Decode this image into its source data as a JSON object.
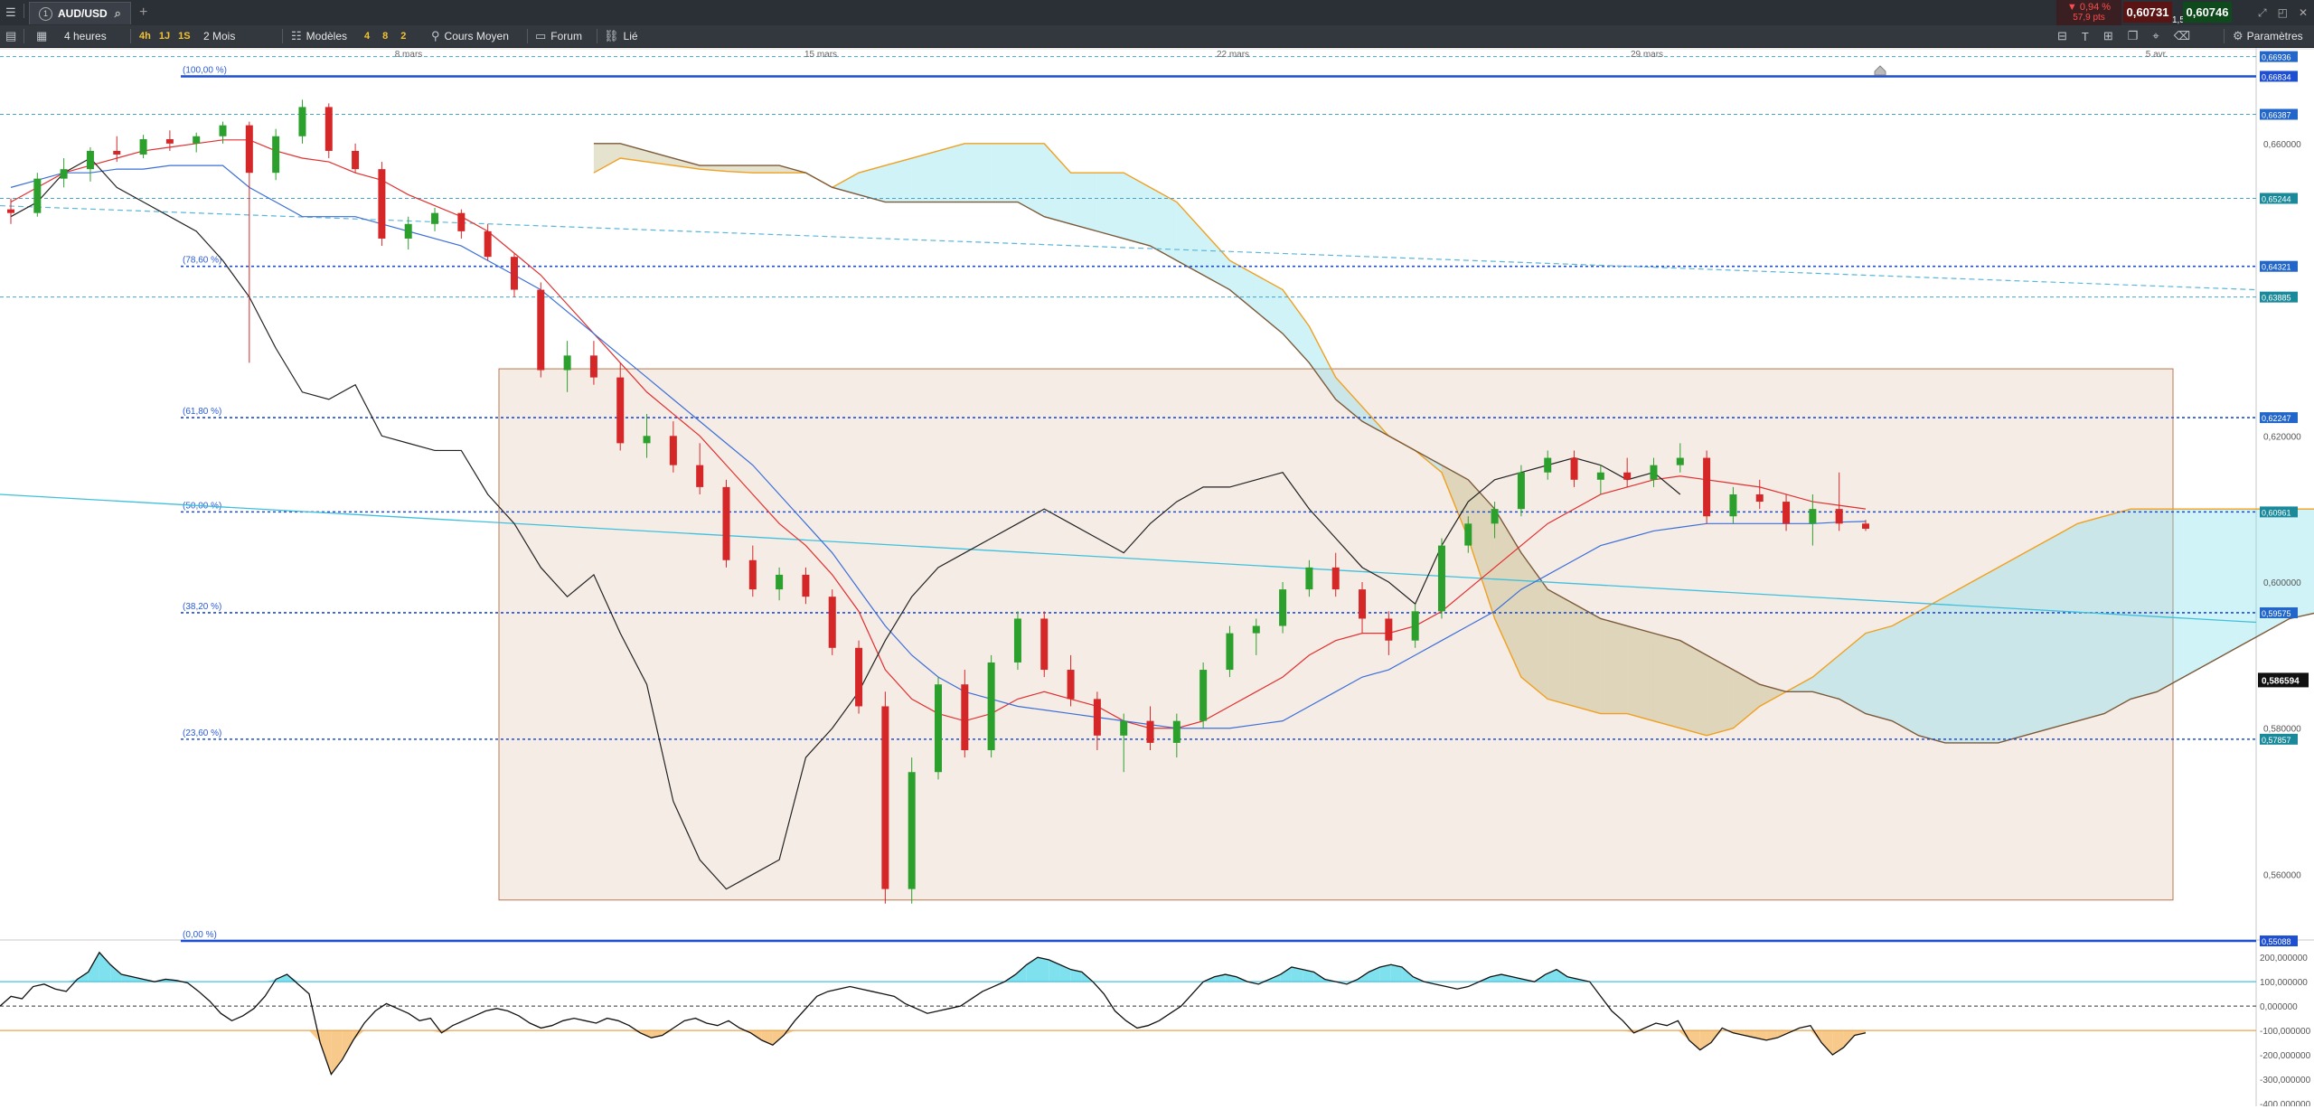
{
  "topbar": {
    "menu_icon": "hamburger-icon",
    "instrument": "AUD/USD",
    "instrument_badge": "1",
    "add_tab": "+",
    "change_pct": "▼ 0,94 %",
    "change_pts": "57,9 pts",
    "bid": "0,60731",
    "spread": "1,5",
    "ask": "0,60746",
    "window_icons": [
      "minimize-icon",
      "restore-icon",
      "close-icon"
    ]
  },
  "toolbar": {
    "timeframe": "4 heures",
    "tf_buttons": [
      "4h",
      "1J",
      "1S"
    ],
    "range": "2 Mois",
    "templates": "Modèles",
    "template_counts": [
      "4",
      "8",
      "2"
    ],
    "average_price": "Cours Moyen",
    "forum": "Forum",
    "linked": "Lié",
    "settings": "Paramètres",
    "colors": {
      "accent_yellow": "#f1c232",
      "down": "#d62728",
      "up": "#2ca02c"
    }
  },
  "chart_data": [
    {
      "type": "candlestick",
      "title": "",
      "x_ticks": [
        "8 mars",
        "15 mars",
        "22 mars",
        "29 mars",
        "5 avr."
      ],
      "y_ticks": [
        "0,660000",
        "0,620000",
        "0,600000",
        "0,580000",
        "0,560000"
      ],
      "ylim": [
        0.5514,
        0.6721
      ],
      "fib_levels": [
        {
          "label": "(100,00 %)",
          "value": 0.6692
        },
        {
          "label": "(78,60 %)",
          "value": 0.6432
        },
        {
          "label": "(61,80 %)",
          "value": 0.6225
        },
        {
          "label": "(50,00 %)",
          "value": 0.6096
        },
        {
          "label": "(38,20 %)",
          "value": 0.5958
        },
        {
          "label": "(23,60 %)",
          "value": 0.5785
        },
        {
          "label": "(0,00 %)",
          "value": 0.5509
        }
      ],
      "axis_price_labels": [
        "0,66936",
        "0,66834",
        "0,66387",
        "0,65244",
        "0,64321",
        "0,63885",
        "0,62247",
        "0,60961",
        "0,59575",
        "0,57857",
        "0,55088"
      ],
      "last_price_label": "0,586594",
      "candles": [
        [
          0.651,
          0.6525,
          0.649,
          0.6505
        ],
        [
          0.6505,
          0.656,
          0.65,
          0.6552
        ],
        [
          0.6552,
          0.658,
          0.654,
          0.6565
        ],
        [
          0.6565,
          0.6595,
          0.6548,
          0.659
        ],
        [
          0.659,
          0.661,
          0.6575,
          0.6585
        ],
        [
          0.6585,
          0.6612,
          0.658,
          0.6606
        ],
        [
          0.6606,
          0.6618,
          0.659,
          0.66
        ],
        [
          0.66,
          0.6615,
          0.6588,
          0.661
        ],
        [
          0.661,
          0.663,
          0.66,
          0.6625
        ],
        [
          0.6625,
          0.663,
          0.63,
          0.656
        ],
        [
          0.656,
          0.662,
          0.655,
          0.661
        ],
        [
          0.661,
          0.666,
          0.66,
          0.665
        ],
        [
          0.665,
          0.6655,
          0.658,
          0.659
        ],
        [
          0.659,
          0.66,
          0.656,
          0.6565
        ],
        [
          0.6565,
          0.6575,
          0.646,
          0.647
        ],
        [
          0.647,
          0.65,
          0.6455,
          0.649
        ],
        [
          0.649,
          0.6512,
          0.648,
          0.6505
        ],
        [
          0.6505,
          0.651,
          0.647,
          0.648
        ],
        [
          0.648,
          0.649,
          0.644,
          0.6445
        ],
        [
          0.6445,
          0.645,
          0.639,
          0.64
        ],
        [
          0.64,
          0.641,
          0.628,
          0.629
        ],
        [
          0.629,
          0.633,
          0.626,
          0.631
        ],
        [
          0.631,
          0.633,
          0.627,
          0.628
        ],
        [
          0.628,
          0.63,
          0.618,
          0.619
        ],
        [
          0.619,
          0.623,
          0.617,
          0.62
        ],
        [
          0.62,
          0.622,
          0.615,
          0.616
        ],
        [
          0.616,
          0.619,
          0.612,
          0.613
        ],
        [
          0.613,
          0.614,
          0.602,
          0.603
        ],
        [
          0.603,
          0.605,
          0.598,
          0.599
        ],
        [
          0.599,
          0.602,
          0.5975,
          0.601
        ],
        [
          0.601,
          0.602,
          0.597,
          0.598
        ],
        [
          0.598,
          0.599,
          0.59,
          0.591
        ],
        [
          0.591,
          0.592,
          0.582,
          0.583
        ],
        [
          0.583,
          0.585,
          0.556,
          0.558
        ],
        [
          0.558,
          0.576,
          0.556,
          0.574
        ],
        [
          0.574,
          0.587,
          0.573,
          0.586
        ],
        [
          0.586,
          0.588,
          0.576,
          0.577
        ],
        [
          0.577,
          0.59,
          0.576,
          0.589
        ],
        [
          0.589,
          0.596,
          0.588,
          0.595
        ],
        [
          0.595,
          0.596,
          0.587,
          0.588
        ],
        [
          0.588,
          0.59,
          0.583,
          0.584
        ],
        [
          0.584,
          0.585,
          0.577,
          0.579
        ],
        [
          0.579,
          0.582,
          0.574,
          0.581
        ],
        [
          0.581,
          0.583,
          0.577,
          0.578
        ],
        [
          0.578,
          0.582,
          0.576,
          0.581
        ],
        [
          0.581,
          0.589,
          0.58,
          0.588
        ],
        [
          0.588,
          0.594,
          0.587,
          0.593
        ],
        [
          0.593,
          0.595,
          0.59,
          0.594
        ],
        [
          0.594,
          0.6,
          0.593,
          0.599
        ],
        [
          0.599,
          0.603,
          0.598,
          0.602
        ],
        [
          0.602,
          0.604,
          0.598,
          0.599
        ],
        [
          0.599,
          0.6,
          0.593,
          0.595
        ],
        [
          0.595,
          0.596,
          0.59,
          0.592
        ],
        [
          0.592,
          0.597,
          0.591,
          0.596
        ],
        [
          0.596,
          0.606,
          0.595,
          0.605
        ],
        [
          0.605,
          0.609,
          0.604,
          0.608
        ],
        [
          0.608,
          0.611,
          0.606,
          0.61
        ],
        [
          0.61,
          0.616,
          0.609,
          0.615
        ],
        [
          0.615,
          0.618,
          0.614,
          0.617
        ],
        [
          0.617,
          0.618,
          0.613,
          0.614
        ],
        [
          0.614,
          0.616,
          0.612,
          0.615
        ],
        [
          0.615,
          0.617,
          0.613,
          0.614
        ],
        [
          0.614,
          0.617,
          0.613,
          0.616
        ],
        [
          0.616,
          0.619,
          0.615,
          0.617
        ],
        [
          0.617,
          0.618,
          0.608,
          0.609
        ],
        [
          0.609,
          0.613,
          0.608,
          0.612
        ],
        [
          0.612,
          0.614,
          0.61,
          0.611
        ],
        [
          0.611,
          0.612,
          0.607,
          0.608
        ],
        [
          0.608,
          0.612,
          0.605,
          0.61
        ],
        [
          0.61,
          0.615,
          0.607,
          0.608
        ],
        [
          0.608,
          0.6085,
          0.607,
          0.6073
        ]
      ],
      "series": [
        {
          "name": "",
          "values": [
            0.652,
            0.654,
            0.656,
            0.657,
            0.658,
            0.659,
            0.6595,
            0.66,
            0.6605,
            0.6605,
            0.659,
            0.658,
            0.6575,
            0.656,
            0.655,
            0.653,
            0.6515,
            0.65,
            0.648,
            0.645,
            0.642,
            0.638,
            0.634,
            0.63,
            0.626,
            0.623,
            0.62,
            0.616,
            0.612,
            0.608,
            0.605,
            0.601,
            0.596,
            0.588,
            0.584,
            0.582,
            0.581,
            0.582,
            0.584,
            0.585,
            0.584,
            0.583,
            0.581,
            0.58,
            0.58,
            0.581,
            0.583,
            0.585,
            0.587,
            0.59,
            0.592,
            0.593,
            0.593,
            0.594,
            0.596,
            0.599,
            0.602,
            0.605,
            0.608,
            0.61,
            0.612,
            0.613,
            0.614,
            0.6145,
            0.614,
            0.6135,
            0.613,
            0.612,
            0.611,
            0.6105,
            0.61
          ]
        },
        {
          "name": "",
          "values": [
            0.654,
            0.655,
            0.656,
            0.656,
            0.6565,
            0.6565,
            0.657,
            0.657,
            0.657,
            0.654,
            0.652,
            0.65,
            0.65,
            0.65,
            0.649,
            0.648,
            0.647,
            0.646,
            0.644,
            0.642,
            0.64,
            0.637,
            0.634,
            0.631,
            0.628,
            0.625,
            0.622,
            0.619,
            0.616,
            0.612,
            0.608,
            0.604,
            0.599,
            0.594,
            0.59,
            0.587,
            0.585,
            0.584,
            0.583,
            0.5825,
            0.582,
            0.5815,
            0.581,
            0.5805,
            0.58,
            0.58,
            0.58,
            0.5805,
            0.581,
            0.583,
            0.585,
            0.587,
            0.588,
            0.59,
            0.592,
            0.594,
            0.596,
            0.599,
            0.601,
            0.603,
            0.605,
            0.606,
            0.607,
            0.6075,
            0.608,
            0.608,
            0.608,
            0.608,
            0.608,
            0.6082,
            0.6083
          ]
        },
        {
          "name": "",
          "values": [
            0.65,
            0.652,
            0.656,
            0.658,
            0.654,
            0.652,
            0.65,
            0.648,
            0.644,
            0.639,
            0.632,
            0.626,
            0.625,
            0.627,
            0.62,
            0.619,
            0.618,
            0.618,
            0.612,
            0.608,
            0.602,
            0.598,
            0.601,
            0.593,
            0.586,
            0.57,
            0.562,
            0.558,
            0.56,
            0.562,
            0.576,
            0.58,
            0.585,
            0.592,
            0.598,
            0.602,
            0.604,
            0.606,
            0.608,
            0.61,
            0.608,
            0.606,
            0.604,
            0.608,
            0.611,
            0.613,
            0.613,
            0.614,
            0.615,
            0.61,
            0.606,
            0.602,
            0.6,
            0.597,
            0.605,
            0.611,
            0.614,
            0.615,
            0.616,
            0.617,
            0.616,
            0.614,
            0.615,
            0.612,
            null,
            null,
            null,
            null,
            null,
            null,
            null
          ]
        }
      ],
      "cloud": {
        "span_a": [
          0.656,
          0.658,
          0.6575,
          0.657,
          0.6565,
          0.6562,
          0.656,
          0.656,
          0.656,
          0.654,
          0.656,
          0.657,
          0.658,
          0.659,
          0.66,
          0.66,
          0.66,
          0.66,
          0.656,
          0.656,
          0.656,
          0.654,
          0.652,
          0.648,
          0.644,
          0.642,
          0.64,
          0.635,
          0.628,
          0.624,
          0.62,
          0.618,
          0.615,
          0.606,
          0.595,
          0.587,
          0.584,
          0.583,
          0.582,
          0.582,
          0.581,
          0.58,
          0.579,
          0.58,
          0.583,
          0.585,
          0.587,
          0.59,
          0.593,
          0.594,
          0.596,
          0.598,
          0.6,
          0.602,
          0.604,
          0.606,
          0.608,
          0.609,
          0.61,
          0.61,
          0.61,
          0.61,
          0.61,
          0.61,
          0.61,
          0.61,
          0.6105,
          0.611,
          0.6115,
          0.612,
          0.6125
        ],
        "span_b": [
          0.66,
          0.66,
          0.659,
          0.658,
          0.657,
          0.657,
          0.657,
          0.657,
          0.656,
          0.654,
          0.653,
          0.652,
          0.652,
          0.652,
          0.652,
          0.652,
          0.652,
          0.65,
          0.649,
          0.648,
          0.647,
          0.646,
          0.644,
          0.642,
          0.64,
          0.637,
          0.634,
          0.63,
          0.625,
          0.622,
          0.62,
          0.618,
          0.616,
          0.614,
          0.61,
          0.604,
          0.599,
          0.597,
          0.595,
          0.594,
          0.593,
          0.592,
          0.59,
          0.588,
          0.586,
          0.585,
          0.585,
          0.584,
          0.582,
          0.581,
          0.579,
          0.578,
          0.578,
          0.578,
          0.579,
          0.58,
          0.581,
          0.582,
          0.584,
          0.585,
          0.587,
          0.589,
          0.591,
          0.593,
          0.595,
          0.5958,
          0.5958,
          0.5958,
          0.5958,
          0.5958,
          0.5958
        ]
      }
    },
    {
      "type": "line",
      "title": "",
      "y_ticks": [
        "200,000000",
        "100,000000",
        "0,000000",
        "-100,000000",
        "-200,000000",
        "-300,000000",
        "-400,000000"
      ],
      "ylim": [
        -400,
        260
      ],
      "levels": [
        100,
        0,
        -100
      ],
      "values": [
        0,
        40,
        30,
        80,
        90,
        70,
        60,
        110,
        140,
        220,
        170,
        130,
        120,
        110,
        100,
        110,
        105,
        95,
        60,
        20,
        -30,
        -60,
        -40,
        -10,
        40,
        110,
        130,
        90,
        50,
        -150,
        -280,
        -220,
        -140,
        -70,
        -20,
        10,
        -10,
        -30,
        -60,
        -50,
        -110,
        -80,
        -60,
        -40,
        -20,
        -10,
        -20,
        -40,
        -70,
        -90,
        -80,
        -60,
        -50,
        -60,
        -70,
        -50,
        -60,
        -80,
        -110,
        -130,
        -120,
        -90,
        -60,
        -50,
        -70,
        -80,
        -60,
        -90,
        -110,
        -140,
        -160,
        -120,
        -60,
        -10,
        40,
        60,
        70,
        80,
        70,
        60,
        50,
        40,
        10,
        -10,
        -30,
        -20,
        -10,
        0,
        30,
        60,
        80,
        100,
        130,
        170,
        200,
        190,
        170,
        150,
        140,
        100,
        50,
        -20,
        -60,
        -90,
        -80,
        -60,
        -30,
        0,
        50,
        100,
        120,
        130,
        120,
        100,
        90,
        110,
        130,
        160,
        150,
        140,
        110,
        100,
        90,
        110,
        140,
        160,
        170,
        160,
        120,
        100,
        90,
        80,
        70,
        80,
        100,
        120,
        130,
        120,
        110,
        100,
        130,
        150,
        120,
        110,
        100,
        40,
        -20,
        -60,
        -110,
        -90,
        -70,
        -80,
        -60,
        -140,
        -180,
        -150,
        -90,
        -110,
        -120,
        -130,
        -140,
        -130,
        -110,
        -90,
        -80,
        -150,
        -200,
        -170,
        -120,
        -110
      ]
    }
  ]
}
